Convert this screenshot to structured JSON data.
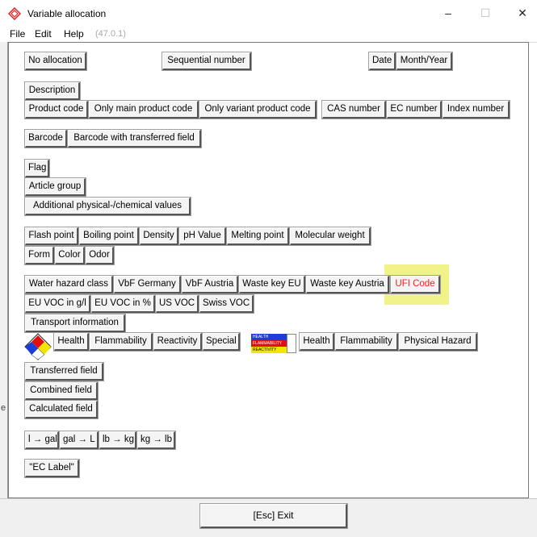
{
  "window": {
    "title": "Variable allocation",
    "minimize": "–",
    "maximize": "☐",
    "close": "✕"
  },
  "menu": {
    "file": "File",
    "edit": "Edit",
    "help": "Help",
    "version": "(47.0.1)"
  },
  "buttons": {
    "no_allocation": "No allocation",
    "sequential_number": "Sequential number",
    "date": "Date",
    "month_year": "Month/Year",
    "description": "Description",
    "product_code": "Product code",
    "only_main_product_code": "Only main product code",
    "only_variant_product_code": "Only variant product code",
    "cas_number": "CAS number",
    "ec_number": "EC number",
    "index_number": "Index number",
    "barcode": "Barcode",
    "barcode_with_transferred_field": "Barcode with transferred field",
    "flag": "Flag",
    "article_group": "Article group",
    "additional_values": "Additional physical-/chemical values",
    "flash_point": "Flash point",
    "boiling_point": "Boiling point",
    "density": "Density",
    "ph_value": "pH Value",
    "melting_point": "Melting point",
    "molecular_weight": "Molecular weight",
    "form": "Form",
    "color": "Color",
    "odor": "Odor",
    "water_hazard_class": "Water hazard class",
    "vbf_germany": "VbF Germany",
    "vbf_austria": "VbF Austria",
    "waste_key_eu": "Waste key EU",
    "waste_key_austria": "Waste key Austria",
    "ufi_code": "UFI Code",
    "eu_voc_gl": "EU VOC in g/l",
    "eu_voc_pct": "EU VOC in %",
    "us_voc": "US VOC",
    "swiss_voc": "Swiss VOC",
    "transport_information": "Transport information",
    "nfpa_health": "Health",
    "nfpa_flammability": "Flammability",
    "nfpa_reactivity": "Reactivity",
    "nfpa_special": "Special",
    "hmis_health": "Health",
    "hmis_flammability": "Flammability",
    "hmis_physical_hazard": "Physical Hazard",
    "transferred_field": "Transferred field",
    "combined_field": "Combined field",
    "calculated_field": "Calculated field",
    "l_to_gal": "l → gal",
    "gal_to_l": "gal → L",
    "lb_to_kg": "lb → kg",
    "kg_to_lb": "kg → lb",
    "ec_label": "\"EC Label\"",
    "exit": "[Esc] Exit"
  },
  "hmis_label": {
    "health": "HEALTH",
    "flammability": "FLAMMABILITY",
    "reactivity": "REACTIVITY"
  },
  "edge_fragment": "e",
  "colors": {
    "highlight": "#f2f28a",
    "ufi_text": "#ff1a1a",
    "nfpa_blue": "#1a3fd8",
    "nfpa_red": "#e01010",
    "nfpa_yellow": "#f2e600"
  }
}
